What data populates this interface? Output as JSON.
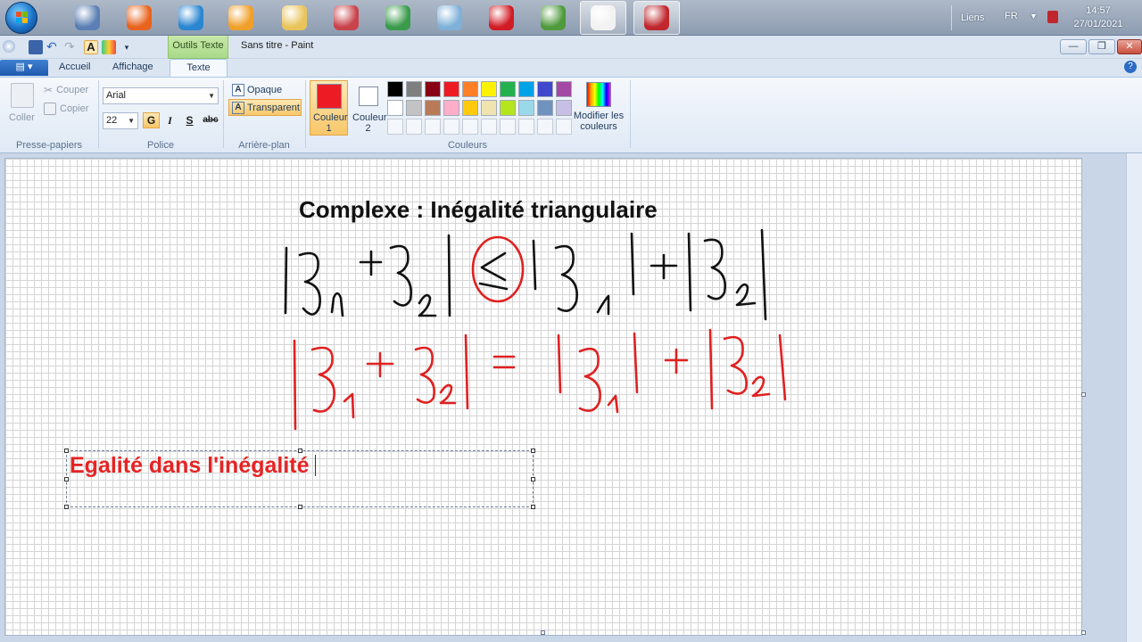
{
  "taskbar": {
    "tray_links": "Liens",
    "tray_lang": "FR",
    "clock_time": "14:57",
    "clock_date": "27/01/2021",
    "apps": [
      {
        "name": "paint-brush-app-icon",
        "color": "#5b7fb5"
      },
      {
        "name": "firefox-icon",
        "color": "#e8641e"
      },
      {
        "name": "internet-explorer-icon",
        "color": "#2a86d1"
      },
      {
        "name": "media-player-icon",
        "color": "#f0a02a"
      },
      {
        "name": "file-explorer-icon",
        "color": "#e9c45b"
      },
      {
        "name": "paint-tools-icon",
        "color": "#c9434b"
      },
      {
        "name": "chrome-icon",
        "color": "#3a9b4b"
      },
      {
        "name": "cube-app-icon",
        "color": "#7fb1d8"
      },
      {
        "name": "opera-icon",
        "color": "#d21c25"
      },
      {
        "name": "spreadsheet-icon",
        "color": "#4f9a3c"
      },
      {
        "name": "paint-palette-icon",
        "color": "#f2f2f2"
      },
      {
        "name": "screen-recorder-icon",
        "color": "#c0272d"
      }
    ]
  },
  "titlebar": {
    "context_tab": "Outils Texte",
    "window_title": "Sans titre - Paint",
    "minimize": "—",
    "maximize": "❐",
    "close": "✕"
  },
  "tabs": {
    "app_menu": "▤ ▾",
    "items": [
      "Accueil",
      "Affichage",
      "Texte"
    ],
    "active": "Texte",
    "help": "?"
  },
  "ribbon": {
    "clipboard": {
      "paste": "Coller",
      "cut": "Couper",
      "copy": "Copier",
      "label": "Presse-papiers"
    },
    "font": {
      "family": "Arial",
      "size": "22",
      "bold": "G",
      "italic": "I",
      "underline": "S",
      "strike": "abc",
      "label": "Police"
    },
    "background": {
      "opaque": "Opaque",
      "transparent": "Transparent",
      "label": "Arrière-plan"
    },
    "colors": {
      "color1_label": "Couleur 1",
      "color1_value": "#ed1c24",
      "color2_label": "Couleur 2",
      "color2_value": "#ffffff",
      "edit": "Modifier les couleurs",
      "label": "Couleurs",
      "palette_row1": [
        "#000000",
        "#7f7f7f",
        "#880015",
        "#ed1c24",
        "#ff7f27",
        "#fff200",
        "#22b14c",
        "#00a2e8",
        "#3f48cc",
        "#a349a4"
      ],
      "palette_row2": [
        "#ffffff",
        "#c3c3c3",
        "#b97a57",
        "#ffaec9",
        "#ffc90e",
        "#efe4b0",
        "#b5e61d",
        "#99d9ea",
        "#7092be",
        "#c8bfe7"
      ]
    }
  },
  "canvas": {
    "title": "Complexe : Inégalité triangulaire",
    "textbox_text": "Egalité dans l'inégalité",
    "ink_black_color": "#111111",
    "ink_red_color": "#e02020"
  }
}
